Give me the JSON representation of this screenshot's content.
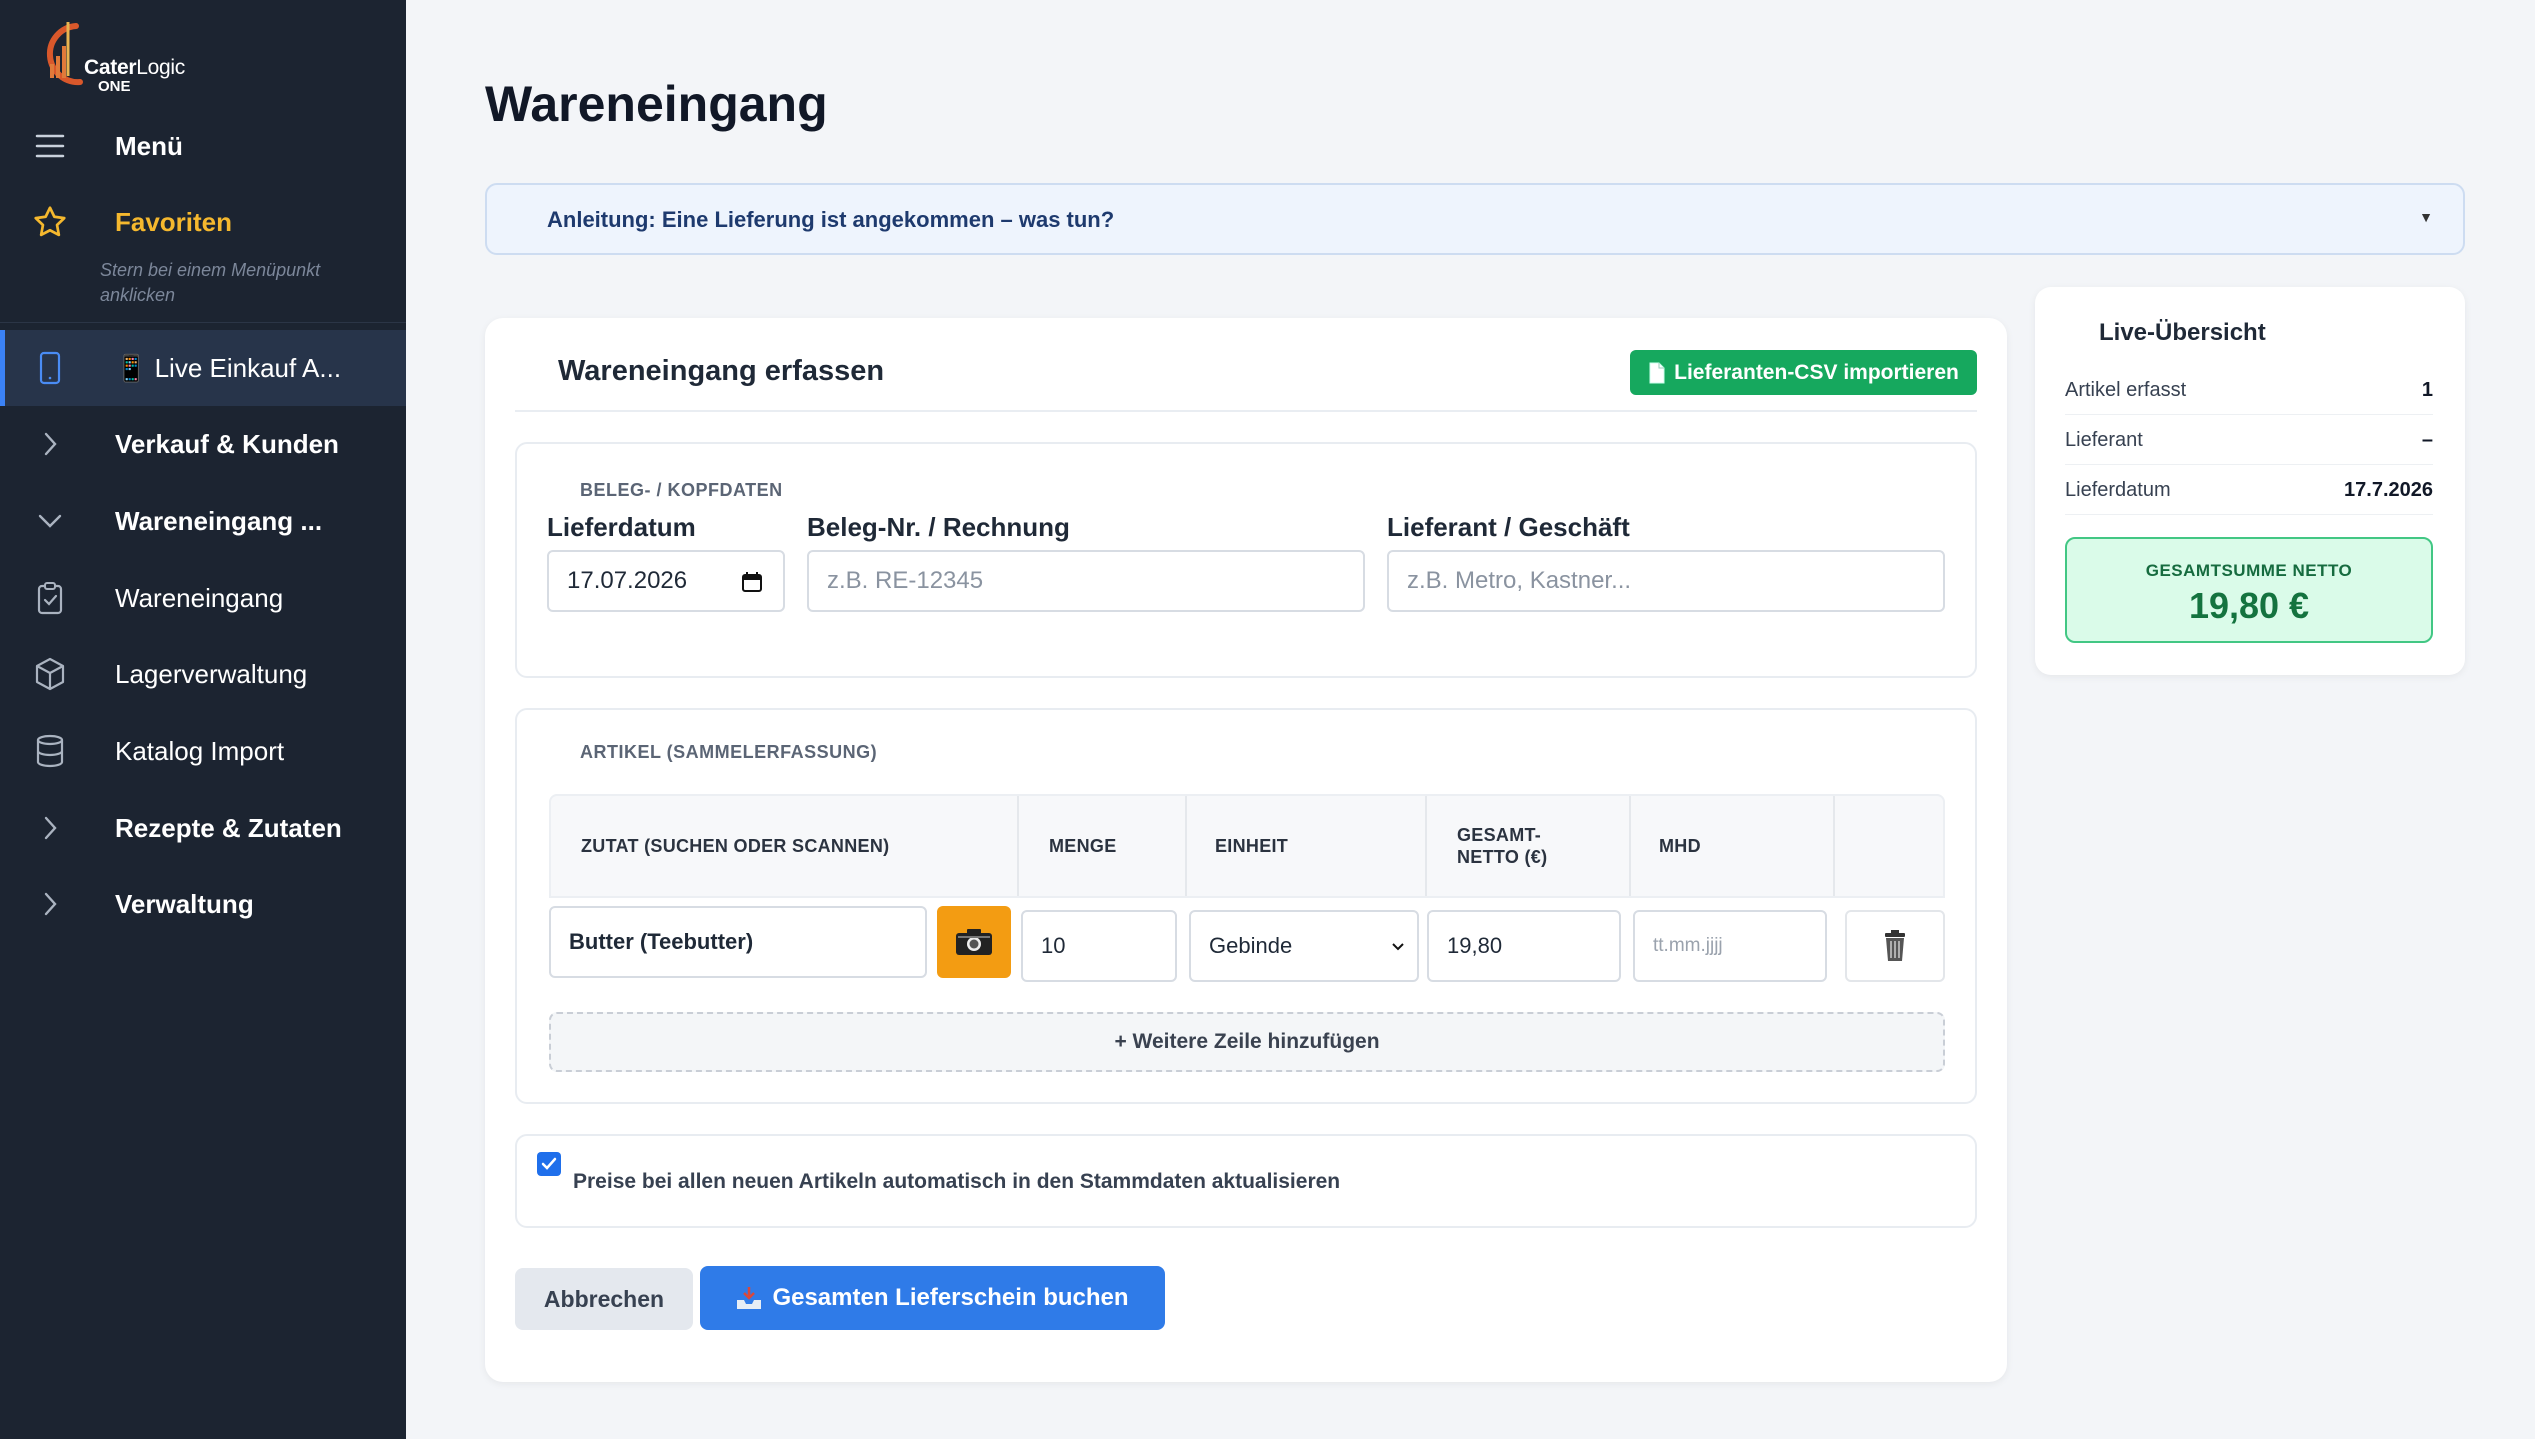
{
  "sidebar": {
    "brand_a": "Cater",
    "brand_b": "Logic",
    "brand_c": "ONE",
    "menu_label": "Menü",
    "favorites_label": "Favoriten",
    "favorites_hint": "Stern bei einem Menüpunkt anklicken",
    "items": [
      {
        "label": "📱 Live Einkauf A...",
        "icon": "phone-icon"
      },
      {
        "label": "Verkauf & Kunden",
        "icon": "chevron-right-icon"
      },
      {
        "label": "Wareneingang ...",
        "icon": "chevron-down-icon"
      },
      {
        "label": "Wareneingang",
        "icon": "clipboard-check-icon"
      },
      {
        "label": "Lagerverwaltung",
        "icon": "box-icon"
      },
      {
        "label": "Katalog Import",
        "icon": "database-icon"
      },
      {
        "label": "Rezepte & Zutaten",
        "icon": "chevron-right-icon"
      },
      {
        "label": "Verwaltung",
        "icon": "chevron-right-icon"
      }
    ]
  },
  "page": {
    "title": "Wareneingang",
    "guide_text": "Anleitung: Eine Lieferung ist angekommen – was tun?",
    "guide_caret": "▼"
  },
  "form": {
    "title": "Wareneingang erfassen",
    "csv_button": "Lieferanten-CSV importieren",
    "header_section": "BELEG- / KOPFDATEN",
    "delivery_date_label": "Lieferdatum",
    "delivery_date_value": "17.07.2026",
    "receipt_label": "Beleg-Nr. / Rechnung",
    "receipt_placeholder": "z.B. RE-12345",
    "supplier_label": "Lieferant / Geschäft",
    "supplier_placeholder": "z.B. Metro, Kastner...",
    "items_section": "ARTIKEL (SAMMELERFASSUNG)",
    "columns": [
      "ZUTAT (SUCHEN ODER SCANNEN)",
      "MENGE",
      "EINHEIT",
      "GESAMT-\nNETTO (€)",
      "MHD"
    ],
    "row": {
      "ingredient": "Butter (Teebutter)",
      "quantity": "10",
      "unit": "Gebinde",
      "net_total": "19,80",
      "mhd_placeholder": "tt.mm.jjjj"
    },
    "add_row": "+ Weitere Zeile hinzufügen",
    "auto_update_label": "Preise bei allen neuen Artikeln automatisch in den Stammdaten aktualisieren",
    "auto_update_checked": true,
    "cancel_button": "Abbrechen",
    "book_button": "Gesamten Lieferschein buchen"
  },
  "live": {
    "title": "Live-Übersicht",
    "rows": [
      {
        "label": "Artikel erfasst",
        "value": "1"
      },
      {
        "label": "Lieferant",
        "value": "–"
      },
      {
        "label": "Lieferdatum",
        "value": "17.7.2026"
      }
    ],
    "total_label": "GESAMTSUMME NETTO",
    "total_value": "19,80 €"
  },
  "colors": {
    "sidebar_bg": "#1c2431",
    "accent_blue": "#2f7be8",
    "favorite_yellow": "#f5b82e",
    "csv_green": "#16a85e",
    "camera_orange": "#f39c12",
    "total_green": "#14733f"
  }
}
